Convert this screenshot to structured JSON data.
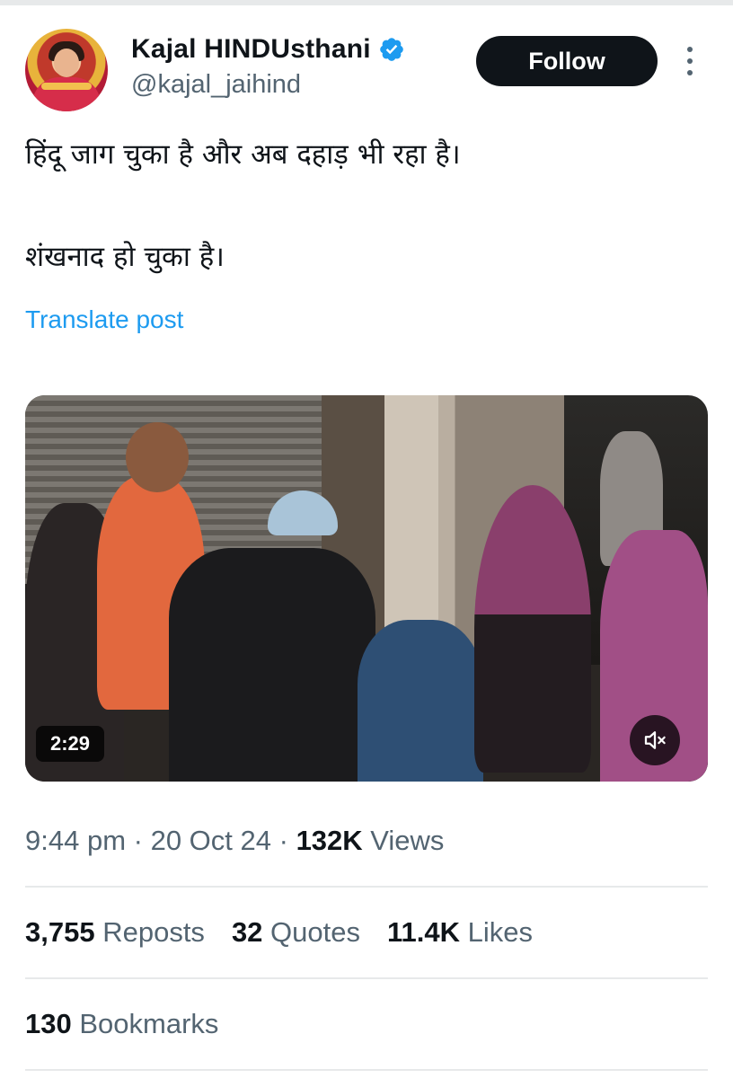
{
  "author": {
    "display_name": "Kajal HINDUsthani",
    "handle": "@kajal_jaihind",
    "verified": true
  },
  "actions": {
    "follow_label": "Follow"
  },
  "post": {
    "line1": "हिंदू जाग चुका है और अब दहाड़ भी रहा है।",
    "line2": "शंखनाद हो चुका है।",
    "translate_label": "Translate post"
  },
  "video": {
    "duration": "2:29",
    "muted": true
  },
  "meta": {
    "time": "9:44 pm",
    "date": "20 Oct 24",
    "views_count": "132K",
    "views_label": "Views"
  },
  "stats": {
    "reposts_count": "3,755",
    "reposts_label": "Reposts",
    "quotes_count": "32",
    "quotes_label": "Quotes",
    "likes_count": "11.4K",
    "likes_label": "Likes",
    "bookmarks_count": "130",
    "bookmarks_label": "Bookmarks"
  },
  "colors": {
    "accent_blue": "#1d9bf0",
    "follow_button_bg": "#0f1419",
    "secondary_text": "#536471"
  },
  "icons": {
    "verified": "verified-badge-icon",
    "more": "more-vertical-icon",
    "mute": "volume-muted-icon"
  }
}
